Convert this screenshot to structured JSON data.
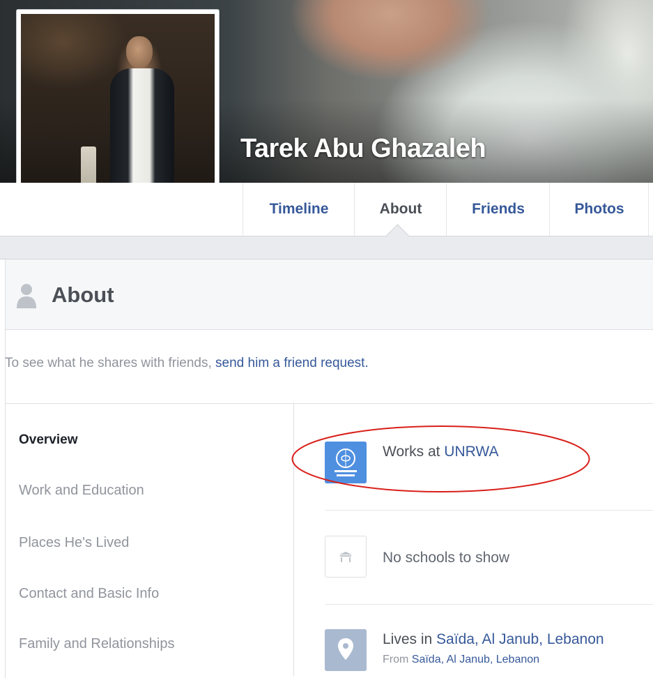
{
  "profile": {
    "name": "Tarek Abu Ghazaleh"
  },
  "tabs": [
    {
      "label": "Timeline",
      "active": false
    },
    {
      "label": "About",
      "active": true
    },
    {
      "label": "Friends",
      "active": false
    },
    {
      "label": "Photos",
      "active": false
    }
  ],
  "about": {
    "title": "About",
    "icon": "person-icon",
    "notice_prefix": "To see what he shares with friends, ",
    "notice_link": "send him a friend request."
  },
  "nav": {
    "items": [
      {
        "label": "Overview",
        "active": true
      },
      {
        "label": "Work and Education",
        "active": false
      },
      {
        "label": "Places He's Lived",
        "active": false
      },
      {
        "label": "Contact and Basic Info",
        "active": false
      },
      {
        "label": "Family and Relationships",
        "active": false
      }
    ]
  },
  "overview": {
    "work": {
      "prefix": "Works at ",
      "link": "UNRWA",
      "icon": "unrwa-logo-icon"
    },
    "school": {
      "text": "No schools to show",
      "icon": "school-icon"
    },
    "lives": {
      "prefix": "Lives in ",
      "link": "Saïda, Al Janub, Lebanon",
      "from_prefix": "From ",
      "from_link": "Saïda, Al Janub, Lebanon",
      "icon": "map-pin-icon"
    }
  },
  "colors": {
    "link": "#365899",
    "annotation": "#d9201a",
    "muted": "#90949c"
  }
}
